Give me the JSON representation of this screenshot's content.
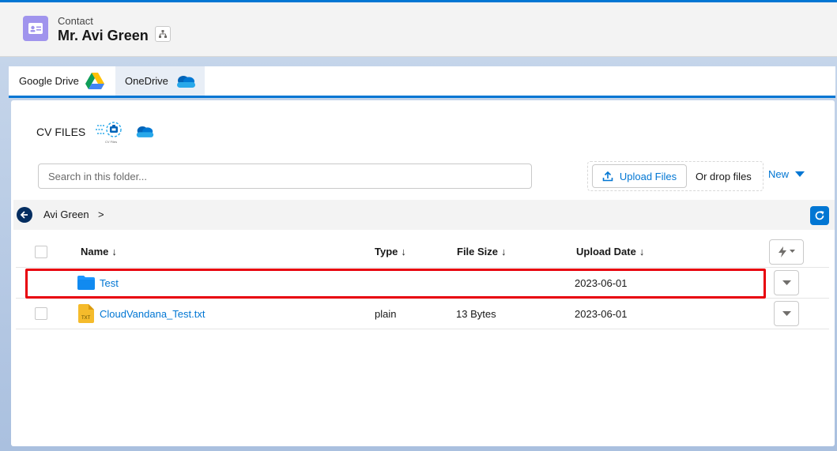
{
  "header": {
    "object_type": "Contact",
    "record_name": "Mr. Avi Green"
  },
  "tabs": [
    {
      "label": "Google Drive",
      "icon": "google-drive-icon",
      "active": false
    },
    {
      "label": "OneDrive",
      "icon": "onedrive-icon",
      "active": true
    }
  ],
  "panel": {
    "title": "CV FILES",
    "logo_caption": "CV Files",
    "search_placeholder": "Search in this folder...",
    "upload_label": "Upload Files",
    "drop_label": "Or drop files",
    "new_label": "New"
  },
  "breadcrumb": {
    "items": [
      "Avi Green"
    ],
    "separator": ">"
  },
  "table": {
    "columns": [
      "Name",
      "Type",
      "File Size",
      "Upload Date"
    ],
    "rows": [
      {
        "name": "Test",
        "kind": "folder",
        "type": "",
        "size": "",
        "date": "2023-06-01",
        "highlighted": true
      },
      {
        "name": "CloudVandana_Test.txt",
        "kind": "txt-file",
        "file_badge": "TXT",
        "type": "plain",
        "size": "13 Bytes",
        "date": "2023-06-01",
        "highlighted": false
      }
    ]
  },
  "colors": {
    "brand_blue": "#0176d3",
    "contact_icon": "#a094ed",
    "highlight": "#e8000b",
    "folder": "#1b96ff",
    "txt_file": "#f5bb2b"
  }
}
